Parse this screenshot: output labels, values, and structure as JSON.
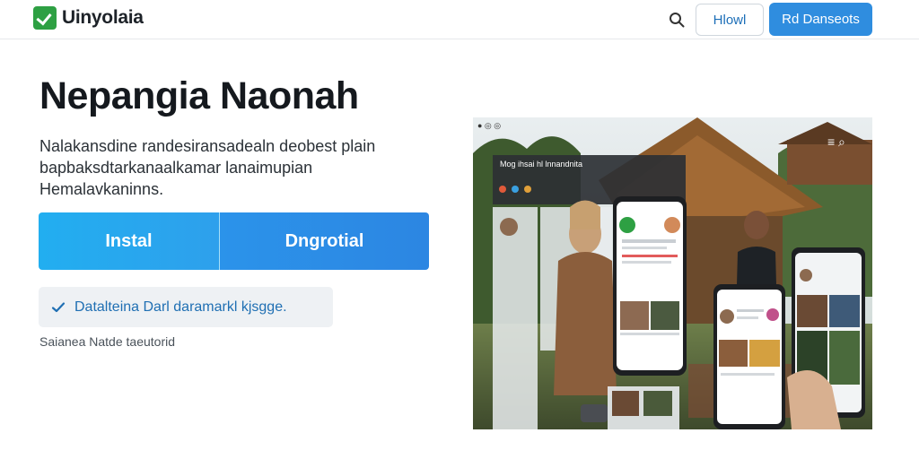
{
  "header": {
    "brand": "Uinyolaia",
    "logo_icon": "check-logo-icon",
    "search_icon": "search-icon",
    "secondary_button": "Hlowl",
    "primary_button": "Rd Danseots"
  },
  "hero": {
    "title": "Nepangia Naonah",
    "description": "Nalakansdine randesiransadealn deobest plain bapbaksdtarkanaalkamar lanaimupian Hemalavkaninns.",
    "cta_install": "Instal",
    "cta_download": "Dngrotial",
    "feature_badge": "Datalteina Darl daramarkl kjsgge.",
    "footnote": "Saianea Natde taeutorid"
  },
  "preview": {
    "overlay_title": "Mog ihsai hl lnnandnita",
    "image_subject": "app-preview-photo"
  },
  "colors": {
    "brand_green": "#2ea043",
    "primary_blue": "#2f8ddf",
    "cta_cyan": "#22aef0",
    "text_dark": "#15191e"
  }
}
